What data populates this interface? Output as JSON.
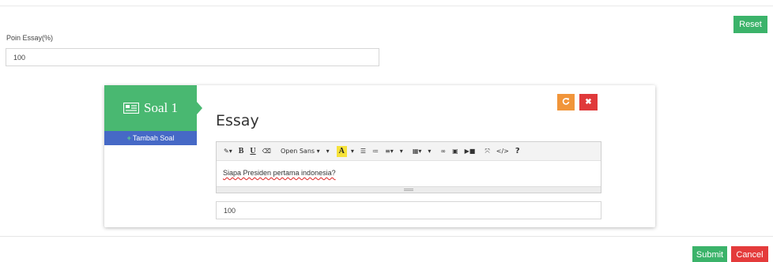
{
  "buttons": {
    "reset": "Reset",
    "submit": "Submit",
    "cancel": "Cancel"
  },
  "poin_essay": {
    "label": "Poin Essay(%)",
    "value": "100"
  },
  "question_card": {
    "soal_label": "Soal 1",
    "soal_icon": "newspaper-icon",
    "tambah_label": "Tambah Soal",
    "title": "Essay",
    "refresh_icon": "refresh-icon",
    "close_icon": "close-icon",
    "editor": {
      "toolbar": {
        "magic_icon": "magic-wand-icon",
        "bold": "B",
        "underline": "U",
        "eraser_icon": "eraser-icon",
        "font_family": "Open Sans",
        "font_color": "A",
        "ul_icon": "unordered-list-icon",
        "ol_icon": "ordered-list-icon",
        "align_icon": "align-icon",
        "table_icon": "table-icon",
        "link_icon": "link-icon",
        "image_icon": "image-icon",
        "video_icon": "video-icon",
        "fullscreen_icon": "fullscreen-icon",
        "code_icon": "code-view-icon",
        "help": "?"
      },
      "content": "Siapa Presiden pertama indonesia?"
    },
    "score_value": "100"
  },
  "colors": {
    "green": "#3bb36a",
    "soal_green": "#49b871",
    "blue": "#4669c6",
    "orange": "#f1953a",
    "red": "#e0393a"
  }
}
